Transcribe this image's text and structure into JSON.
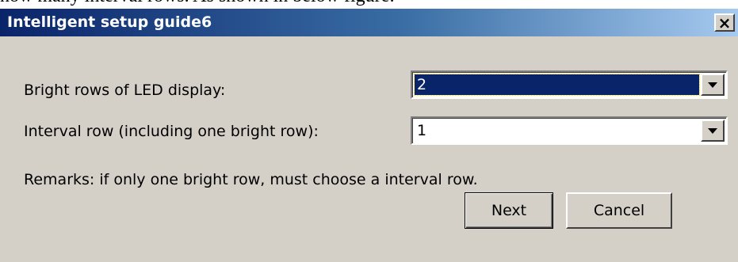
{
  "doc_fragment": "how many interval rows. As shown in below figure:",
  "window": {
    "title": "Intelligent setup guide6",
    "close_glyph": "×"
  },
  "fields": {
    "bright_rows": {
      "label": "Bright rows of LED display:",
      "value": "2"
    },
    "interval_row": {
      "label": "Interval row (including one bright row):",
      "value": "1"
    }
  },
  "remarks": "Remarks: if only one bright row, must choose a interval row.",
  "buttons": {
    "next": "Next",
    "cancel": "Cancel"
  },
  "icons": {
    "close": "close-icon",
    "dropdown": "chevron-down-icon"
  },
  "colors": {
    "titlebar_start": "#0a246a",
    "titlebar_end": "#a6caf0",
    "dialog_bg": "#d4d0c8",
    "selection_bg": "#0a246a"
  }
}
